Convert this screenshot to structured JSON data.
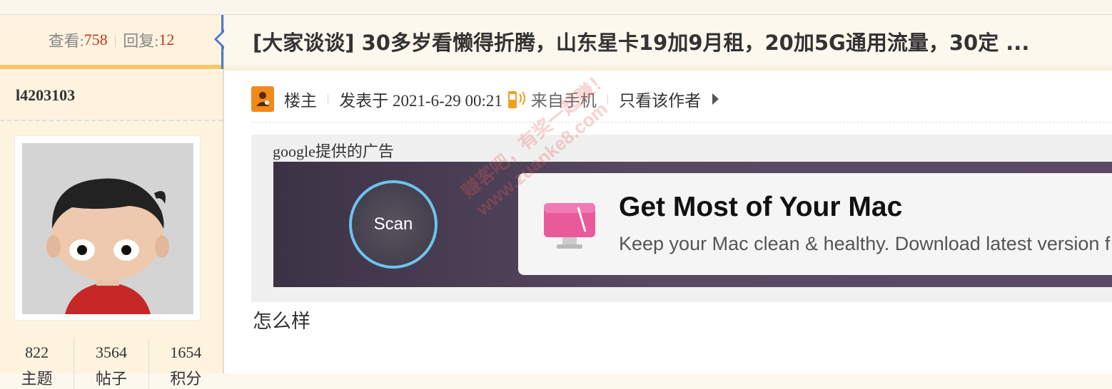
{
  "stats": {
    "views_label": "查看:",
    "views_value": "758",
    "replies_label": "回复:",
    "replies_value": "12"
  },
  "author": {
    "username": "l4203103"
  },
  "counts": [
    {
      "value": "822",
      "label": "主题"
    },
    {
      "value": "3564",
      "label": "帖子"
    },
    {
      "value": "1654",
      "label": "积分"
    }
  ],
  "thread": {
    "title": "[大家谈谈] 30多岁看懒得折腾，山东星卡19加9月租，20加5G通用流量，30定 ..."
  },
  "meta": {
    "role": "楼主",
    "posted": "发表于 2021-6-29 00:21",
    "source": "来自手机",
    "only_author": "只看该作者"
  },
  "ad": {
    "label": "google提供的广告",
    "scan_label": "Scan",
    "headline": "Get Most of Your Mac",
    "subline": "Keep your Mac clean & healthy. Download latest version f"
  },
  "watermark": {
    "line1": "赚客吧，有奖一起赚！",
    "line2": "www.zuanke8.com"
  },
  "post": {
    "body": "怎么样"
  },
  "colors": {
    "accent_orange": "#f5c66a",
    "value_red": "#c0391d",
    "pointer_blue": "#4a7cc7"
  }
}
